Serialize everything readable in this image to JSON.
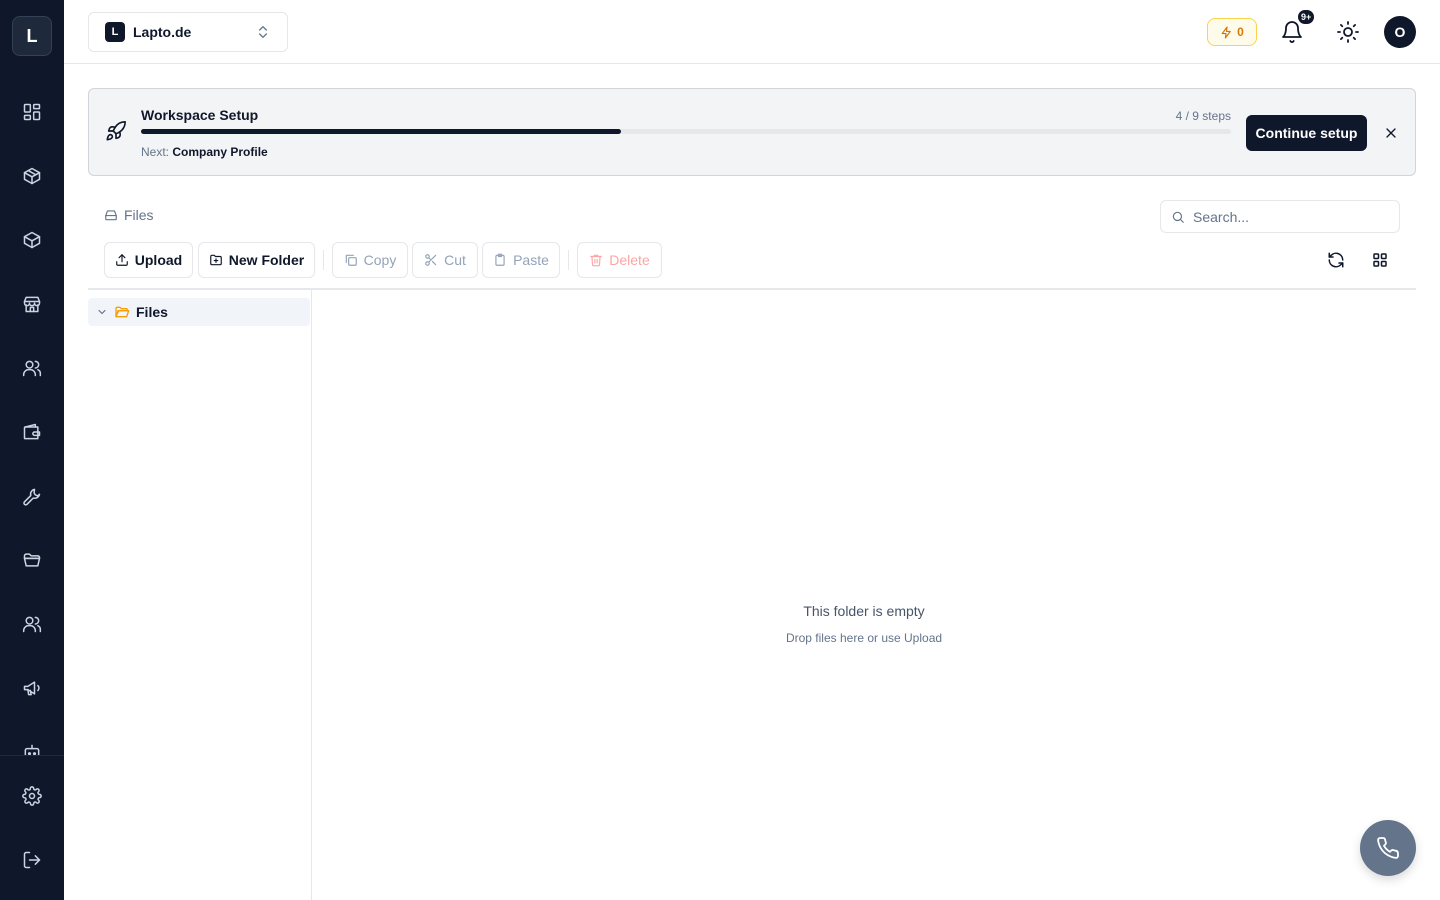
{
  "sidebar": {
    "logo_letter": "L",
    "items": [
      "dashboard-icon",
      "package-icon",
      "box-icon",
      "store-icon",
      "users-icon",
      "wallet-icon",
      "wrench-icon",
      "folder-icon",
      "team-icon",
      "megaphone-icon",
      "bot-icon"
    ],
    "bottom_items": [
      "gear-icon",
      "logout-icon"
    ]
  },
  "topbar": {
    "workspace_badge": "L",
    "workspace_name": "Lapto.de",
    "credits": "0",
    "notifications_badge": "9+",
    "avatar_letter": "O"
  },
  "setup_banner": {
    "title": "Workspace Setup",
    "steps_text": "4 / 9 steps",
    "progress": 0.44,
    "next_label": "Next:",
    "next_value": "Company Profile",
    "continue_label": "Continue setup"
  },
  "files": {
    "breadcrumb": "Files",
    "search_placeholder": "Search...",
    "toolbar": {
      "upload": "Upload",
      "new_folder": "New Folder",
      "copy": "Copy",
      "cut": "Cut",
      "paste": "Paste",
      "delete": "Delete"
    },
    "tree": [
      {
        "label": "Files",
        "expanded": true
      }
    ],
    "empty_title": "This folder is empty",
    "empty_subtitle": "Drop files here or use Upload"
  },
  "colors": {
    "sidebar_bg": "#0f172a",
    "primary": "#0f172a",
    "credits_accent": "#d97706",
    "folder": "#f59e0b",
    "danger_disabled": "#fca5a5"
  }
}
